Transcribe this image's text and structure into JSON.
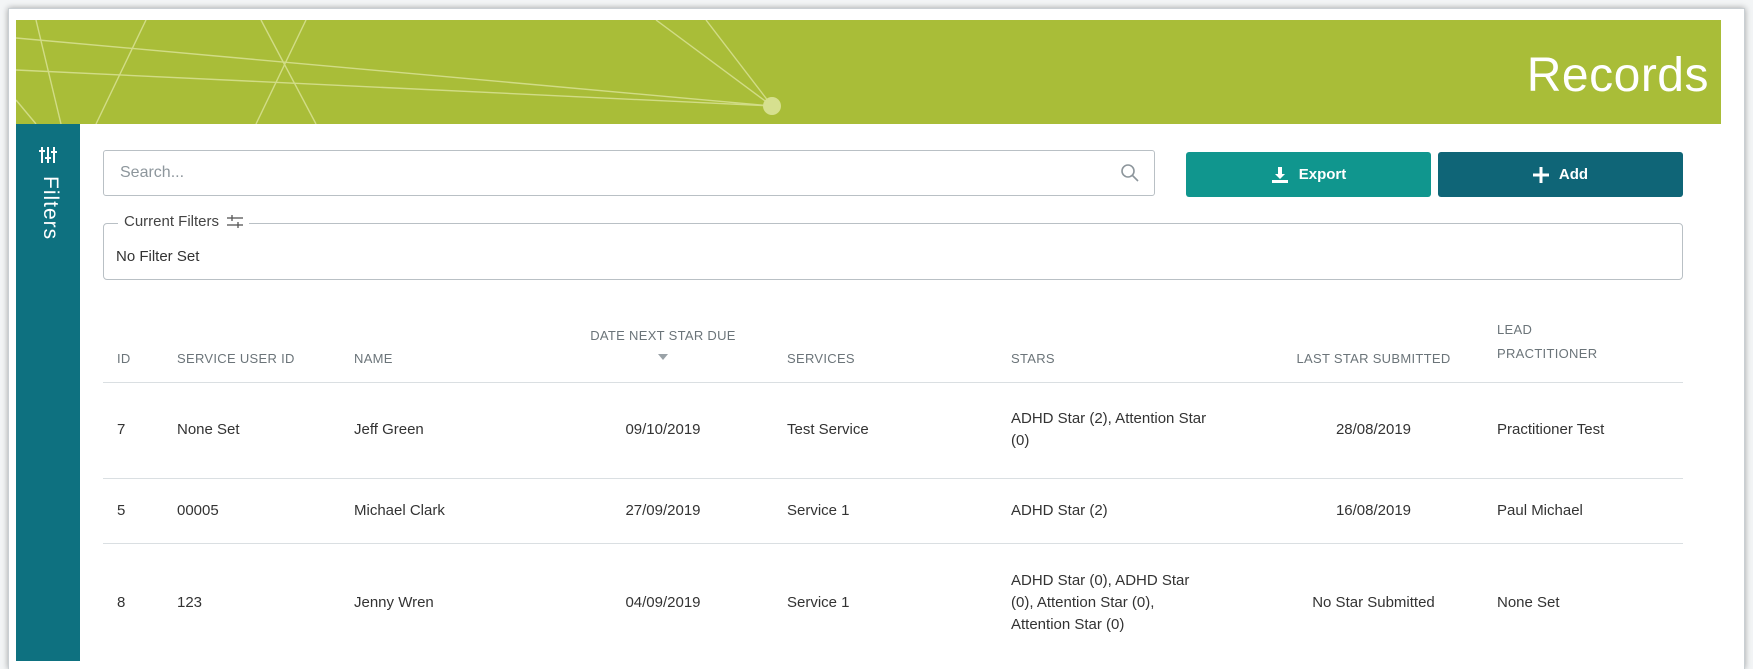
{
  "page": {
    "title": "Records"
  },
  "sidebar": {
    "filters_label": "Filters",
    "icon": "sliders-icon"
  },
  "search": {
    "placeholder": "Search..."
  },
  "toolbar": {
    "export_label": "Export",
    "add_label": "Add",
    "export_color": "#10968e",
    "add_color": "#0f6577"
  },
  "filters": {
    "legend": "Current Filters",
    "value": "No Filter Set"
  },
  "colors": {
    "banner": "#a9bd38",
    "rail": "#0e7180"
  },
  "table": {
    "headers": {
      "id": "ID",
      "service_user_id": "SERVICE USER ID",
      "name": "NAME",
      "date_next_star_due": "DATE NEXT STAR DUE",
      "services": "SERVICES",
      "stars": "STARS",
      "last_star_submitted": "LAST STAR SUBMITTED",
      "lead_practitioner_1": "LEAD",
      "lead_practitioner_2": "PRACTITIONER"
    },
    "rows": [
      {
        "id": "7",
        "service_user_id": "None Set",
        "name": "Jeff Green",
        "date_next_star_due": "09/10/2019",
        "services": "Test Service",
        "stars": "ADHD Star (2), Attention Star (0)",
        "last_star_submitted": "28/08/2019",
        "lead_practitioner": "Practitioner Test"
      },
      {
        "id": "5",
        "service_user_id": "00005",
        "name": "Michael Clark",
        "date_next_star_due": "27/09/2019",
        "services": "Service 1",
        "stars": "ADHD Star (2)",
        "last_star_submitted": "16/08/2019",
        "lead_practitioner": "Paul Michael"
      },
      {
        "id": "8",
        "service_user_id": "123",
        "name": "Jenny Wren",
        "date_next_star_due": "04/09/2019",
        "services": "Service 1",
        "stars": "ADHD Star (0), ADHD Star (0), Attention Star (0), Attention Star (0)",
        "last_star_submitted": "No Star Submitted",
        "lead_practitioner": "None Set"
      }
    ]
  }
}
